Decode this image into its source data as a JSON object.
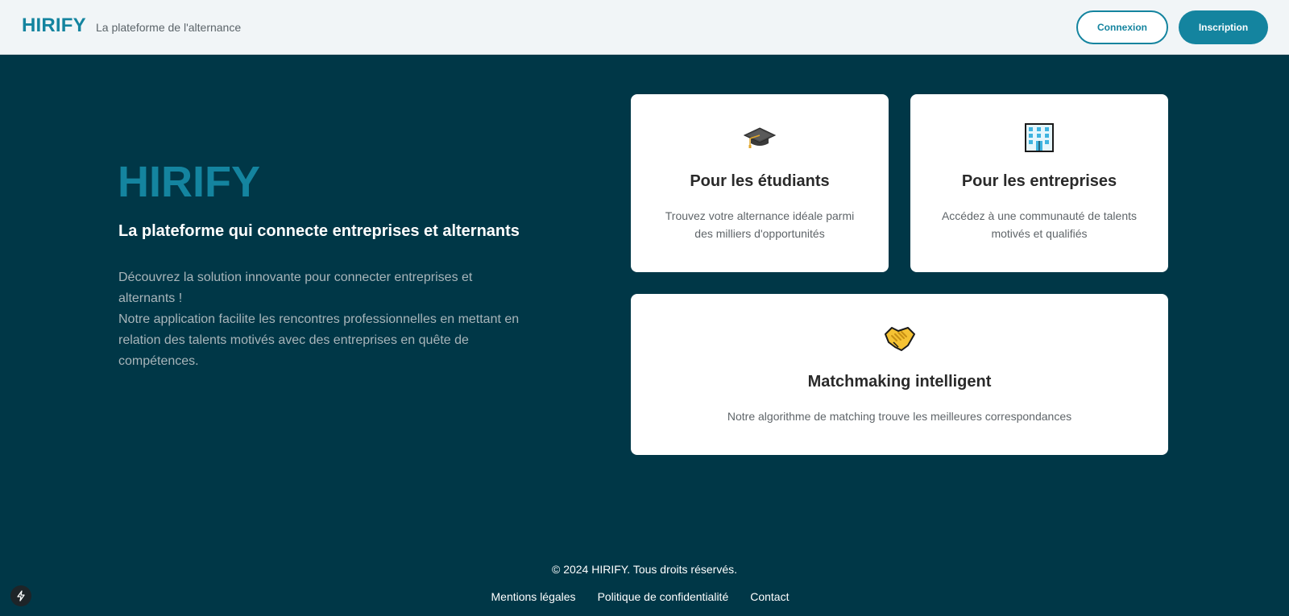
{
  "header": {
    "brand": "HIRIFY",
    "tagline": "La plateforme de l'alternance",
    "login_label": "Connexion",
    "signup_label": "Inscription"
  },
  "hero": {
    "title": "HIRIFY",
    "subtitle": "La plateforme qui connecte entreprises et alternants",
    "description_line1": "Découvrez la solution innovante pour connecter entreprises et alternants !",
    "description_line2": "Notre application facilite les rencontres professionnelles en mettant en relation des talents motivés avec des entreprises en quête de compétences."
  },
  "cards": [
    {
      "icon": "graduation-cap-icon",
      "title": "Pour les étudiants",
      "text": "Trouvez votre alternance idéale parmi des milliers d'opportunités"
    },
    {
      "icon": "office-building-icon",
      "title": "Pour les entreprises",
      "text": "Accédez à une communauté de talents motivés et qualifiés"
    },
    {
      "icon": "handshake-icon",
      "title": "Matchmaking intelligent",
      "text": "Notre algorithme de matching trouve les meilleures correspondances"
    }
  ],
  "footer": {
    "copyright": "© 2024 HIRIFY. Tous droits réservés.",
    "links": [
      "Mentions légales",
      "Politique de confidentialité",
      "Contact"
    ]
  },
  "colors": {
    "brand": "#14849f",
    "background": "#003747",
    "header_bg": "#f1f5f7"
  }
}
